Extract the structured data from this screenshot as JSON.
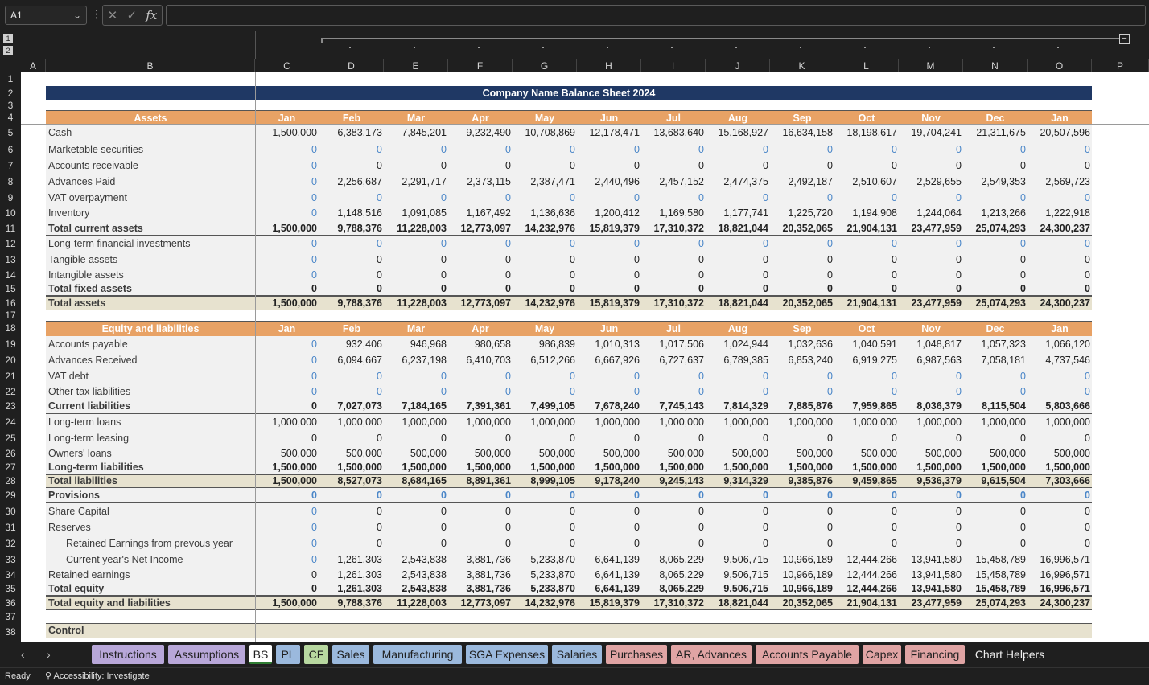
{
  "formula_bar": {
    "name_box": "A1",
    "fx_label": "fx",
    "formula": ""
  },
  "outline": {
    "level1": "1",
    "level2": "2"
  },
  "columns": [
    "A",
    "B",
    "C",
    "D",
    "E",
    "F",
    "G",
    "H",
    "I",
    "J",
    "K",
    "L",
    "M",
    "N",
    "O",
    "P"
  ],
  "sheet": {
    "title": "Company Name Balance Sheet 2024",
    "months": [
      "Jan",
      "Feb",
      "Mar",
      "Apr",
      "May",
      "Jun",
      "Jul",
      "Aug",
      "Sep",
      "Oct",
      "Nov",
      "Dec",
      "Jan"
    ],
    "assets_header": "Assets",
    "equity_header": "Equity and liabilities",
    "control_label": "Control",
    "assets_rows": [
      {
        "row": 5,
        "label": "Cash",
        "style": "normal",
        "values": [
          "1,500,000",
          "6,383,173",
          "7,845,201",
          "9,232,490",
          "10,708,869",
          "12,178,471",
          "13,683,640",
          "15,168,927",
          "16,634,158",
          "18,198,617",
          "19,704,241",
          "21,311,675",
          "20,507,596"
        ]
      },
      {
        "row": 6,
        "label": "Marketable securities",
        "style": "normal",
        "values": [
          "0",
          "0",
          "0",
          "0",
          "0",
          "0",
          "0",
          "0",
          "0",
          "0",
          "0",
          "0",
          "0"
        ],
        "zero": true
      },
      {
        "row": 7,
        "label": "Accounts receivable",
        "style": "normal",
        "values": [
          "0",
          "0",
          "0",
          "0",
          "0",
          "0",
          "0",
          "0",
          "0",
          "0",
          "0",
          "0",
          "0"
        ],
        "zero": "first"
      },
      {
        "row": 8,
        "label": "Advances Paid",
        "style": "normal",
        "values": [
          "0",
          "2,256,687",
          "2,291,717",
          "2,373,115",
          "2,387,471",
          "2,440,496",
          "2,457,152",
          "2,474,375",
          "2,492,187",
          "2,510,607",
          "2,529,655",
          "2,549,353",
          "2,569,723"
        ],
        "zero": "first"
      },
      {
        "row": 9,
        "label": "VAT overpayment",
        "style": "normal",
        "values": [
          "0",
          "0",
          "0",
          "0",
          "0",
          "0",
          "0",
          "0",
          "0",
          "0",
          "0",
          "0",
          "0"
        ],
        "zero": true
      },
      {
        "row": 10,
        "label": "Inventory",
        "style": "normal",
        "values": [
          "0",
          "1,148,516",
          "1,091,085",
          "1,167,492",
          "1,136,636",
          "1,200,412",
          "1,169,580",
          "1,177,741",
          "1,225,720",
          "1,194,908",
          "1,244,064",
          "1,213,266",
          "1,222,918"
        ],
        "zero": "first"
      },
      {
        "row": 11,
        "label": "Total current assets",
        "style": "total",
        "values": [
          "1,500,000",
          "9,788,376",
          "11,228,003",
          "12,773,097",
          "14,232,976",
          "15,819,379",
          "17,310,372",
          "18,821,044",
          "20,352,065",
          "21,904,131",
          "23,477,959",
          "25,074,293",
          "24,300,237"
        ]
      },
      {
        "row": 12,
        "label": "Long-term financial investments",
        "style": "normal",
        "values": [
          "0",
          "0",
          "0",
          "0",
          "0",
          "0",
          "0",
          "0",
          "0",
          "0",
          "0",
          "0",
          "0"
        ],
        "zero": true
      },
      {
        "row": 13,
        "label": "Tangible assets",
        "style": "normal",
        "values": [
          "0",
          "0",
          "0",
          "0",
          "0",
          "0",
          "0",
          "0",
          "0",
          "0",
          "0",
          "0",
          "0"
        ],
        "zero": "first"
      },
      {
        "row": 14,
        "label": "Intangible assets",
        "style": "normal",
        "values": [
          "0",
          "0",
          "0",
          "0",
          "0",
          "0",
          "0",
          "0",
          "0",
          "0",
          "0",
          "0",
          "0"
        ],
        "zero": "first"
      },
      {
        "row": 15,
        "label": "Total fixed assets",
        "style": "total",
        "values": [
          "0",
          "0",
          "0",
          "0",
          "0",
          "0",
          "0",
          "0",
          "0",
          "0",
          "0",
          "0",
          "0"
        ]
      },
      {
        "row": 16,
        "label": "Total assets",
        "style": "grand",
        "values": [
          "1,500,000",
          "9,788,376",
          "11,228,003",
          "12,773,097",
          "14,232,976",
          "15,819,379",
          "17,310,372",
          "18,821,044",
          "20,352,065",
          "21,904,131",
          "23,477,959",
          "25,074,293",
          "24,300,237"
        ]
      }
    ],
    "equity_rows": [
      {
        "row": 19,
        "label": "Accounts payable",
        "style": "normal",
        "values": [
          "0",
          "932,406",
          "946,968",
          "980,658",
          "986,839",
          "1,010,313",
          "1,017,506",
          "1,024,944",
          "1,032,636",
          "1,040,591",
          "1,048,817",
          "1,057,323",
          "1,066,120"
        ],
        "zero": "first"
      },
      {
        "row": 20,
        "label": "Advances Received",
        "style": "normal",
        "values": [
          "0",
          "6,094,667",
          "6,237,198",
          "6,410,703",
          "6,512,266",
          "6,667,926",
          "6,727,637",
          "6,789,385",
          "6,853,240",
          "6,919,275",
          "6,987,563",
          "7,058,181",
          "4,737,546"
        ],
        "zero": "first"
      },
      {
        "row": 21,
        "label": "VAT debt",
        "style": "normal",
        "values": [
          "0",
          "0",
          "0",
          "0",
          "0",
          "0",
          "0",
          "0",
          "0",
          "0",
          "0",
          "0",
          "0"
        ],
        "zero": true
      },
      {
        "row": 22,
        "label": "Other tax liabilities",
        "style": "normal",
        "values": [
          "0",
          "0",
          "0",
          "0",
          "0",
          "0",
          "0",
          "0",
          "0",
          "0",
          "0",
          "0",
          "0"
        ],
        "zero": true
      },
      {
        "row": 23,
        "label": "Current liabilities",
        "style": "total",
        "values": [
          "0",
          "7,027,073",
          "7,184,165",
          "7,391,361",
          "7,499,105",
          "7,678,240",
          "7,745,143",
          "7,814,329",
          "7,885,876",
          "7,959,865",
          "8,036,379",
          "8,115,504",
          "5,803,666"
        ]
      },
      {
        "row": 24,
        "label": "Long-term loans",
        "style": "normal",
        "values": [
          "1,000,000",
          "1,000,000",
          "1,000,000",
          "1,000,000",
          "1,000,000",
          "1,000,000",
          "1,000,000",
          "1,000,000",
          "1,000,000",
          "1,000,000",
          "1,000,000",
          "1,000,000",
          "1,000,000"
        ]
      },
      {
        "row": 25,
        "label": "Long-term leasing",
        "style": "normal",
        "values": [
          "0",
          "0",
          "0",
          "0",
          "0",
          "0",
          "0",
          "0",
          "0",
          "0",
          "0",
          "0",
          "0"
        ]
      },
      {
        "row": 26,
        "label": "Owners' loans",
        "style": "normal",
        "values": [
          "500,000",
          "500,000",
          "500,000",
          "500,000",
          "500,000",
          "500,000",
          "500,000",
          "500,000",
          "500,000",
          "500,000",
          "500,000",
          "500,000",
          "500,000"
        ]
      },
      {
        "row": 27,
        "label": "Long-term liabilities",
        "style": "total",
        "values": [
          "1,500,000",
          "1,500,000",
          "1,500,000",
          "1,500,000",
          "1,500,000",
          "1,500,000",
          "1,500,000",
          "1,500,000",
          "1,500,000",
          "1,500,000",
          "1,500,000",
          "1,500,000",
          "1,500,000"
        ]
      },
      {
        "row": 28,
        "label": "Total liabilities",
        "style": "grand",
        "values": [
          "1,500,000",
          "8,527,073",
          "8,684,165",
          "8,891,361",
          "8,999,105",
          "9,178,240",
          "9,245,143",
          "9,314,329",
          "9,385,876",
          "9,459,865",
          "9,536,379",
          "9,615,504",
          "7,303,666"
        ]
      },
      {
        "row": 29,
        "label": "Provisions",
        "style": "total",
        "values": [
          "0",
          "0",
          "0",
          "0",
          "0",
          "0",
          "0",
          "0",
          "0",
          "0",
          "0",
          "0",
          "0"
        ],
        "zero": true
      },
      {
        "row": 30,
        "label": "Share Capital",
        "style": "normal",
        "values": [
          "0",
          "0",
          "0",
          "0",
          "0",
          "0",
          "0",
          "0",
          "0",
          "0",
          "0",
          "0",
          "0"
        ],
        "zero": "first"
      },
      {
        "row": 31,
        "label": "Reserves",
        "style": "normal",
        "values": [
          "0",
          "0",
          "0",
          "0",
          "0",
          "0",
          "0",
          "0",
          "0",
          "0",
          "0",
          "0",
          "0"
        ],
        "zero": "first"
      },
      {
        "row": 32,
        "label": "Retained Earnings from prevous year",
        "style": "indent",
        "values": [
          "0",
          "0",
          "0",
          "0",
          "0",
          "0",
          "0",
          "0",
          "0",
          "0",
          "0",
          "0",
          "0"
        ],
        "zero": "first"
      },
      {
        "row": 33,
        "label": "Current year's Net Income",
        "style": "indent",
        "values": [
          "0",
          "1,261,303",
          "2,543,838",
          "3,881,736",
          "5,233,870",
          "6,641,139",
          "8,065,229",
          "9,506,715",
          "10,966,189",
          "12,444,266",
          "13,941,580",
          "15,458,789",
          "16,996,571"
        ],
        "zero": "first"
      },
      {
        "row": 34,
        "label": "Retained earnings",
        "style": "normal",
        "values": [
          "0",
          "1,261,303",
          "2,543,838",
          "3,881,736",
          "5,233,870",
          "6,641,139",
          "8,065,229",
          "9,506,715",
          "10,966,189",
          "12,444,266",
          "13,941,580",
          "15,458,789",
          "16,996,571"
        ]
      },
      {
        "row": 35,
        "label": "Total equity",
        "style": "total",
        "values": [
          "0",
          "1,261,303",
          "2,543,838",
          "3,881,736",
          "5,233,870",
          "6,641,139",
          "8,065,229",
          "9,506,715",
          "10,966,189",
          "12,444,266",
          "13,941,580",
          "15,458,789",
          "16,996,571"
        ]
      },
      {
        "row": 36,
        "label": "Total equity and liabilities",
        "style": "grand",
        "values": [
          "1,500,000",
          "9,788,376",
          "11,228,003",
          "12,773,097",
          "14,232,976",
          "15,819,379",
          "17,310,372",
          "18,821,044",
          "20,352,065",
          "21,904,131",
          "23,477,959",
          "25,074,293",
          "24,300,237"
        ]
      }
    ]
  },
  "tabs": [
    {
      "label": "Instructions",
      "color": "purple"
    },
    {
      "label": "Assumptions",
      "color": "purple"
    },
    {
      "label": "BS",
      "color": "active"
    },
    {
      "label": "PL",
      "color": "blue"
    },
    {
      "label": "CF",
      "color": "green"
    },
    {
      "label": "Sales",
      "color": "blue"
    },
    {
      "label": "Manufacturing",
      "color": "blue"
    },
    {
      "label": "SGA Expenses",
      "color": "blue"
    },
    {
      "label": "Salaries",
      "color": "blue"
    },
    {
      "label": "Purchases",
      "color": "red"
    },
    {
      "label": "AR, Advances",
      "color": "red"
    },
    {
      "label": "Accounts Payable",
      "color": "red"
    },
    {
      "label": "Capex",
      "color": "red"
    },
    {
      "label": "Financing",
      "color": "red"
    },
    {
      "label": "Chart Helpers",
      "color": "plain"
    }
  ],
  "status": {
    "ready": "Ready",
    "accessibility": "Accessibility: Investigate"
  },
  "theme": {
    "navy": "#1f3864",
    "orange": "#e8a265",
    "tan": "#e7e2cf",
    "zero_blue": "#4a86c8"
  }
}
